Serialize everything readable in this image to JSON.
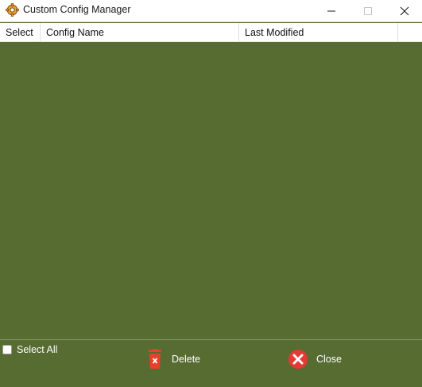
{
  "window": {
    "title": "Custom Config Manager",
    "icon": "gear-app-icon"
  },
  "grid": {
    "columns": [
      "Select",
      "Config Name",
      "Last Modified"
    ],
    "rows": []
  },
  "footer": {
    "select_all_label": "Select All",
    "select_all_checked": false,
    "delete_label": "Delete",
    "close_label": "Close"
  },
  "colors": {
    "background": "#576c31",
    "delete_icon": "#e8412a",
    "close_icon": "#e53935"
  }
}
